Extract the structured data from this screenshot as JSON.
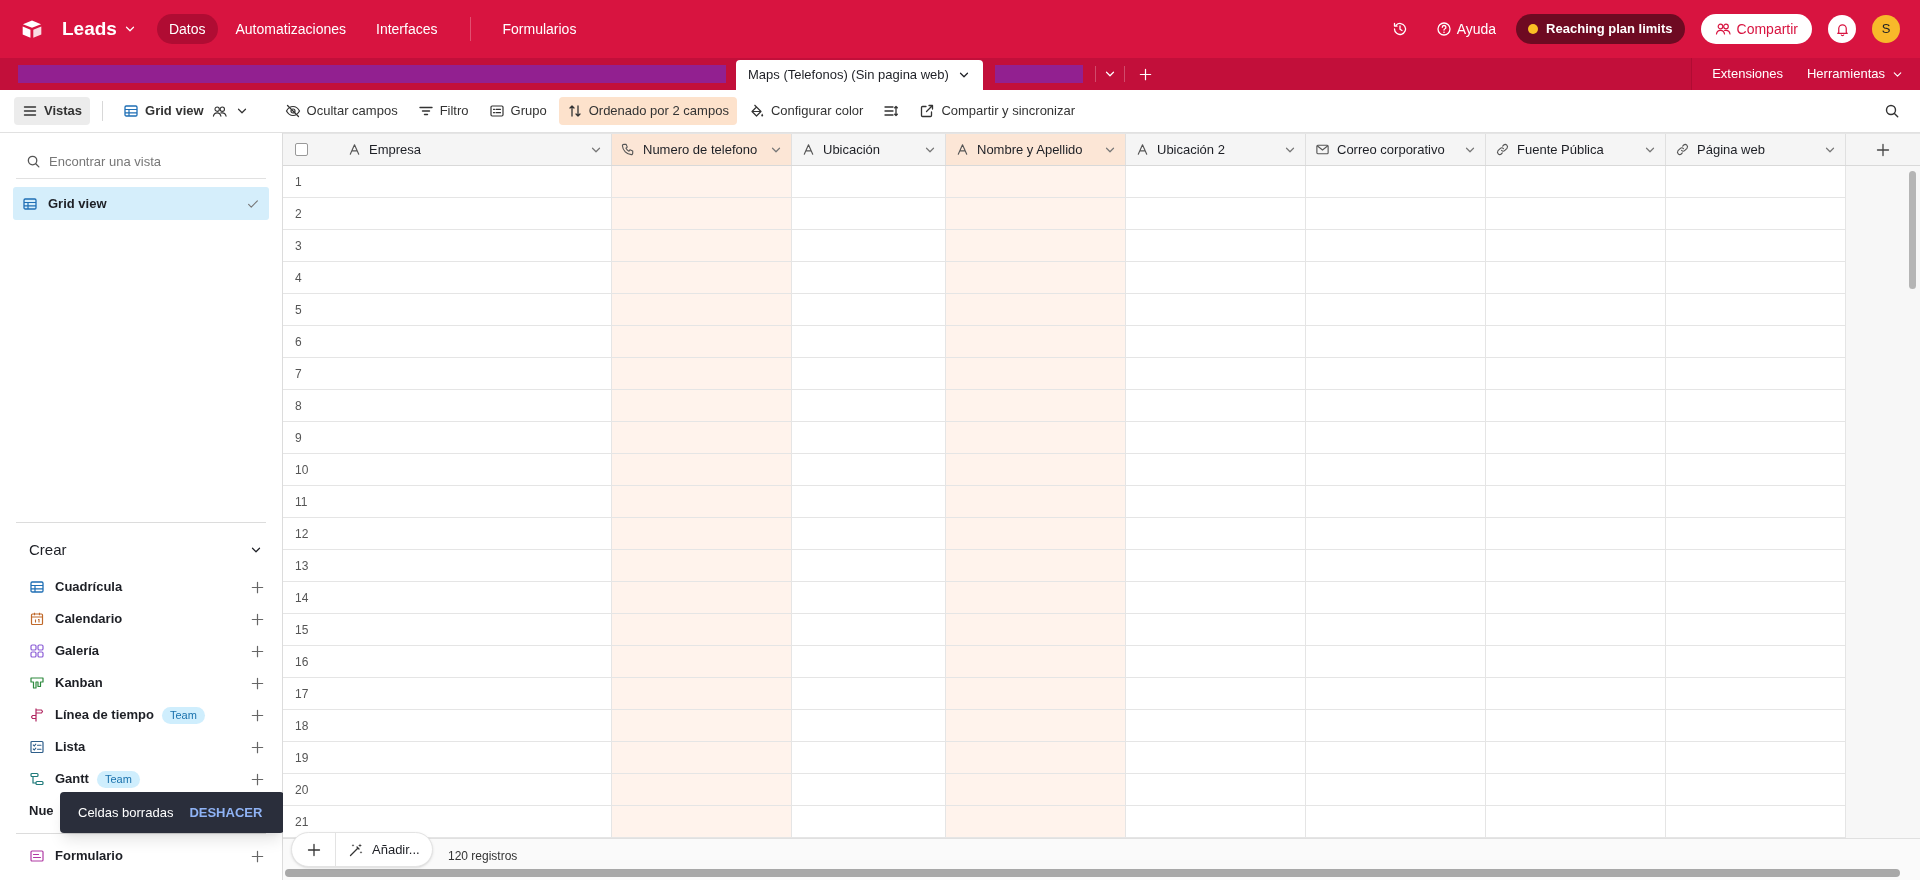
{
  "app": {
    "title": "Leads",
    "nav": [
      {
        "label": "Datos",
        "selected": true
      },
      {
        "label": "Automatizaciones",
        "selected": false
      },
      {
        "label": "Interfaces",
        "selected": false
      },
      {
        "label": "Formularios",
        "selected": false
      }
    ],
    "help": "Ayuda",
    "plan_notice": "Reaching plan limits",
    "share": "Compartir",
    "avatar": "S"
  },
  "table_tabs": {
    "tabs": [
      {
        "kind": "redacted"
      },
      {
        "kind": "tab",
        "label": "Maps (Telefonos) (Sin pagina web)",
        "selected": true
      },
      {
        "kind": "redacted"
      }
    ],
    "extensions": "Extensiones",
    "tools": "Herramientas"
  },
  "toolbar": [
    {
      "kind": "views",
      "label": "Vistas",
      "active": true
    },
    {
      "kind": "grid_view",
      "label": "Grid view",
      "active": false
    },
    {
      "kind": "hide",
      "label": "Ocultar campos",
      "active": false
    },
    {
      "kind": "filter",
      "label": "Filtro",
      "active": false
    },
    {
      "kind": "group",
      "label": "Grupo",
      "active": false
    },
    {
      "kind": "sort",
      "label": "Ordenado por 2 campos",
      "active": true
    },
    {
      "kind": "color",
      "label": "Configurar color",
      "active": false
    },
    {
      "kind": "row_height",
      "active": false
    },
    {
      "kind": "share",
      "label": "Compartir y sincronizar",
      "active": false
    }
  ],
  "sidebar": {
    "search_placeholder": "Encontrar una vista",
    "views": [
      {
        "label": "Grid view",
        "selected": true
      }
    ],
    "create_title": "Crear",
    "create_items": [
      {
        "kind": "grid",
        "label": "Cuadrícula"
      },
      {
        "kind": "calendar",
        "label": "Calendario"
      },
      {
        "kind": "gallery",
        "label": "Galería"
      },
      {
        "kind": "kanban",
        "label": "Kanban"
      },
      {
        "kind": "timeline",
        "label": "Línea de tiempo",
        "badge": "Team"
      },
      {
        "kind": "list",
        "label": "Lista"
      },
      {
        "kind": "gantt",
        "label": "Gantt",
        "badge": "Team"
      },
      {
        "kind": "section",
        "label": "Nue"
      }
    ],
    "footer_items": [
      {
        "kind": "form",
        "label": "Formulario"
      }
    ]
  },
  "toast": {
    "message": "Celdas borradas",
    "action": "DESHACER"
  },
  "grid": {
    "all_selected": false,
    "columns": [
      {
        "name": "Empresa",
        "kind": "text",
        "sorted": false
      },
      {
        "name": "Numero de telefono",
        "kind": "phone",
        "sorted": true
      },
      {
        "name": "Ubicación",
        "kind": "text",
        "sorted": false
      },
      {
        "name": "Nombre y Apellido",
        "kind": "text",
        "sorted": true
      },
      {
        "name": "Ubicación 2",
        "kind": "text",
        "sorted": false
      },
      {
        "name": "Correo corporativo",
        "kind": "email",
        "sorted": false
      },
      {
        "name": "Fuente Pública",
        "kind": "link",
        "sorted": false
      },
      {
        "name": "Página web",
        "kind": "link",
        "sorted": false
      }
    ],
    "rows": [
      "1",
      "2",
      "3",
      "4",
      "5",
      "6",
      "7",
      "8",
      "9",
      "10",
      "11",
      "12",
      "13",
      "14",
      "15",
      "16",
      "17",
      "18",
      "19",
      "20",
      "21"
    ],
    "footer": {
      "add_label": "Añadir...",
      "record_count": "120 registros"
    }
  }
}
